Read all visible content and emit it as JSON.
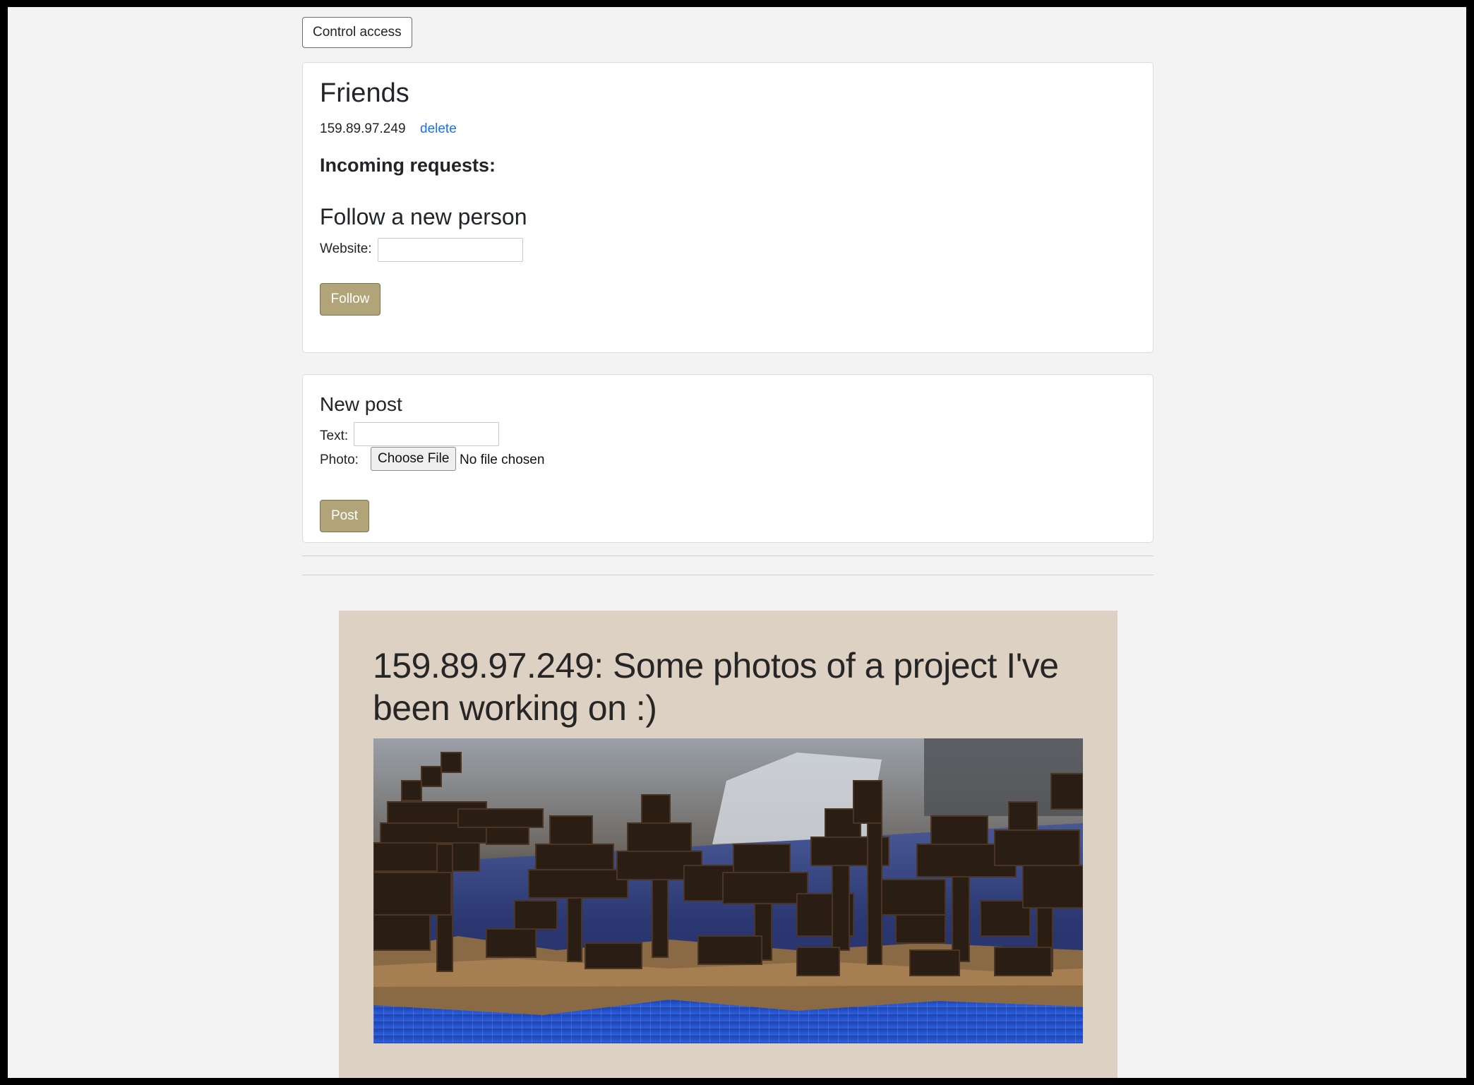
{
  "toolbar": {
    "control_access_label": "Control access"
  },
  "friends": {
    "heading": "Friends",
    "list": [
      {
        "address": "159.89.97.249",
        "delete_label": "delete"
      }
    ],
    "incoming_heading": "Incoming requests:",
    "follow_heading": "Follow a new person",
    "website_label": "Website:",
    "website_value": "",
    "follow_button": "Follow"
  },
  "new_post": {
    "heading": "New post",
    "text_label": "Text:",
    "text_value": "",
    "photo_label": "Photo:",
    "choose_file_label": "Choose File",
    "no_file_label": "No file chosen",
    "post_button": "Post"
  },
  "feed": {
    "posts": [
      {
        "title": "159.89.97.249: Some photos of a project I've been working on :)",
        "photo_icon": "voxel-forest-photo"
      }
    ]
  },
  "colors": {
    "accent_button": "#b0a478",
    "link": "#1a73e8",
    "post_background": "#dcd1c2",
    "page_background": "#f3f3f3"
  }
}
